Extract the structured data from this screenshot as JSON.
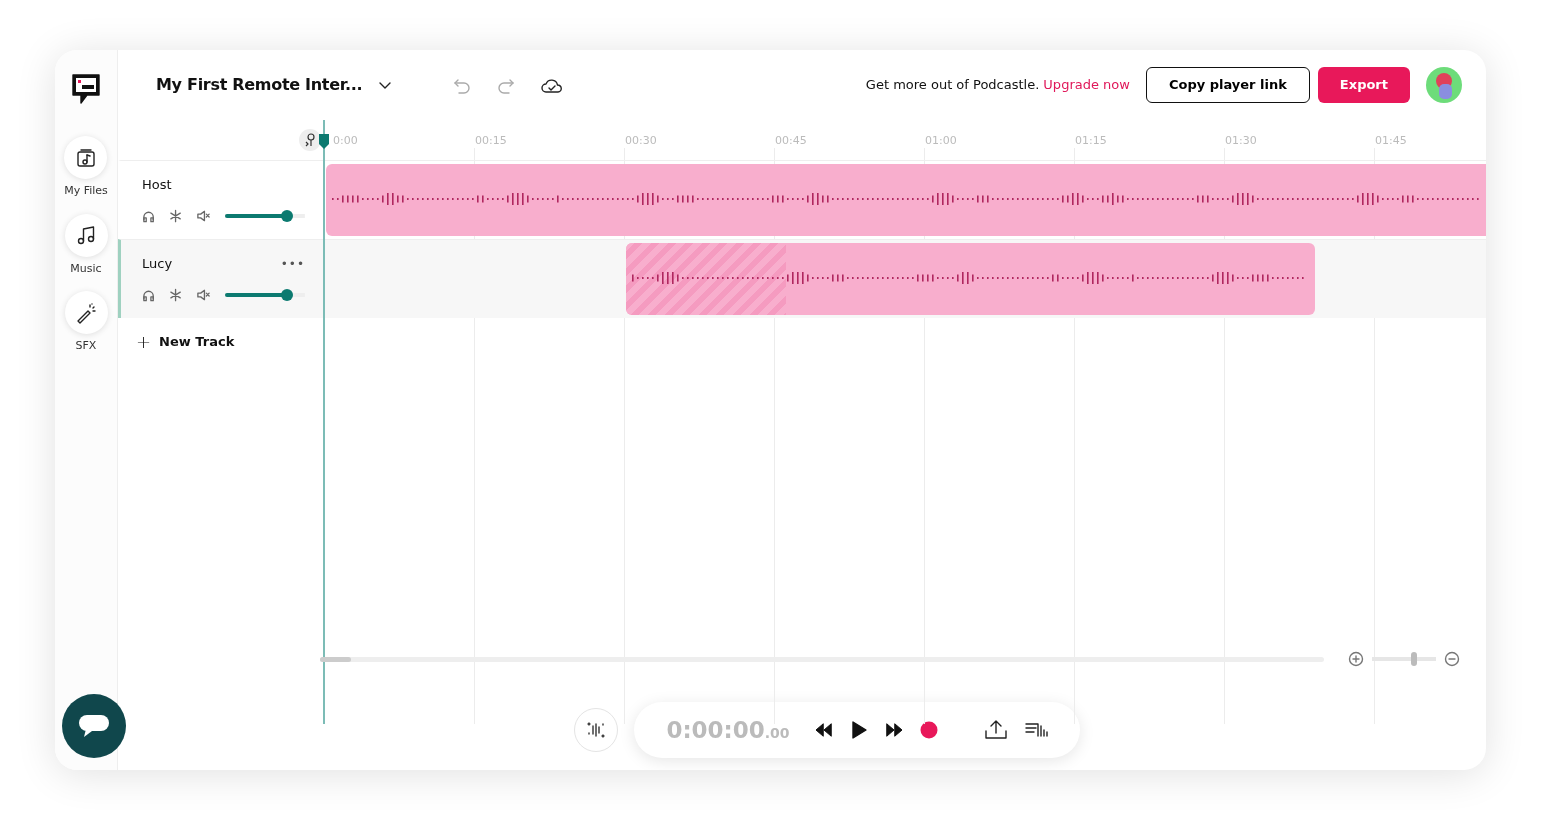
{
  "sidebar": {
    "items": [
      {
        "label": "My Files",
        "kind": "files"
      },
      {
        "label": "Music",
        "kind": "music"
      },
      {
        "label": "SFX",
        "kind": "sfx"
      }
    ]
  },
  "header": {
    "project_title": "My First Remote Inter...",
    "promo_text": "Get more out of Podcastle.",
    "upgrade_link": "Upgrade now",
    "copy_button": "Copy player link",
    "export_button": "Export"
  },
  "ruler": {
    "labels": [
      "0:00",
      "00:15",
      "00:30",
      "00:45",
      "01:00",
      "01:15",
      "01:30",
      "01:45"
    ]
  },
  "tracks": [
    {
      "name": "Host",
      "selected": false,
      "level": 0.78
    },
    {
      "name": "Lucy",
      "selected": true,
      "menu": "•••",
      "level": 0.78
    }
  ],
  "new_track": {
    "icon": "+",
    "label": "New Track"
  },
  "zoom": {
    "level": 0.65
  },
  "transport": {
    "time": "0:00:00",
    "time_fraction": ".00"
  }
}
